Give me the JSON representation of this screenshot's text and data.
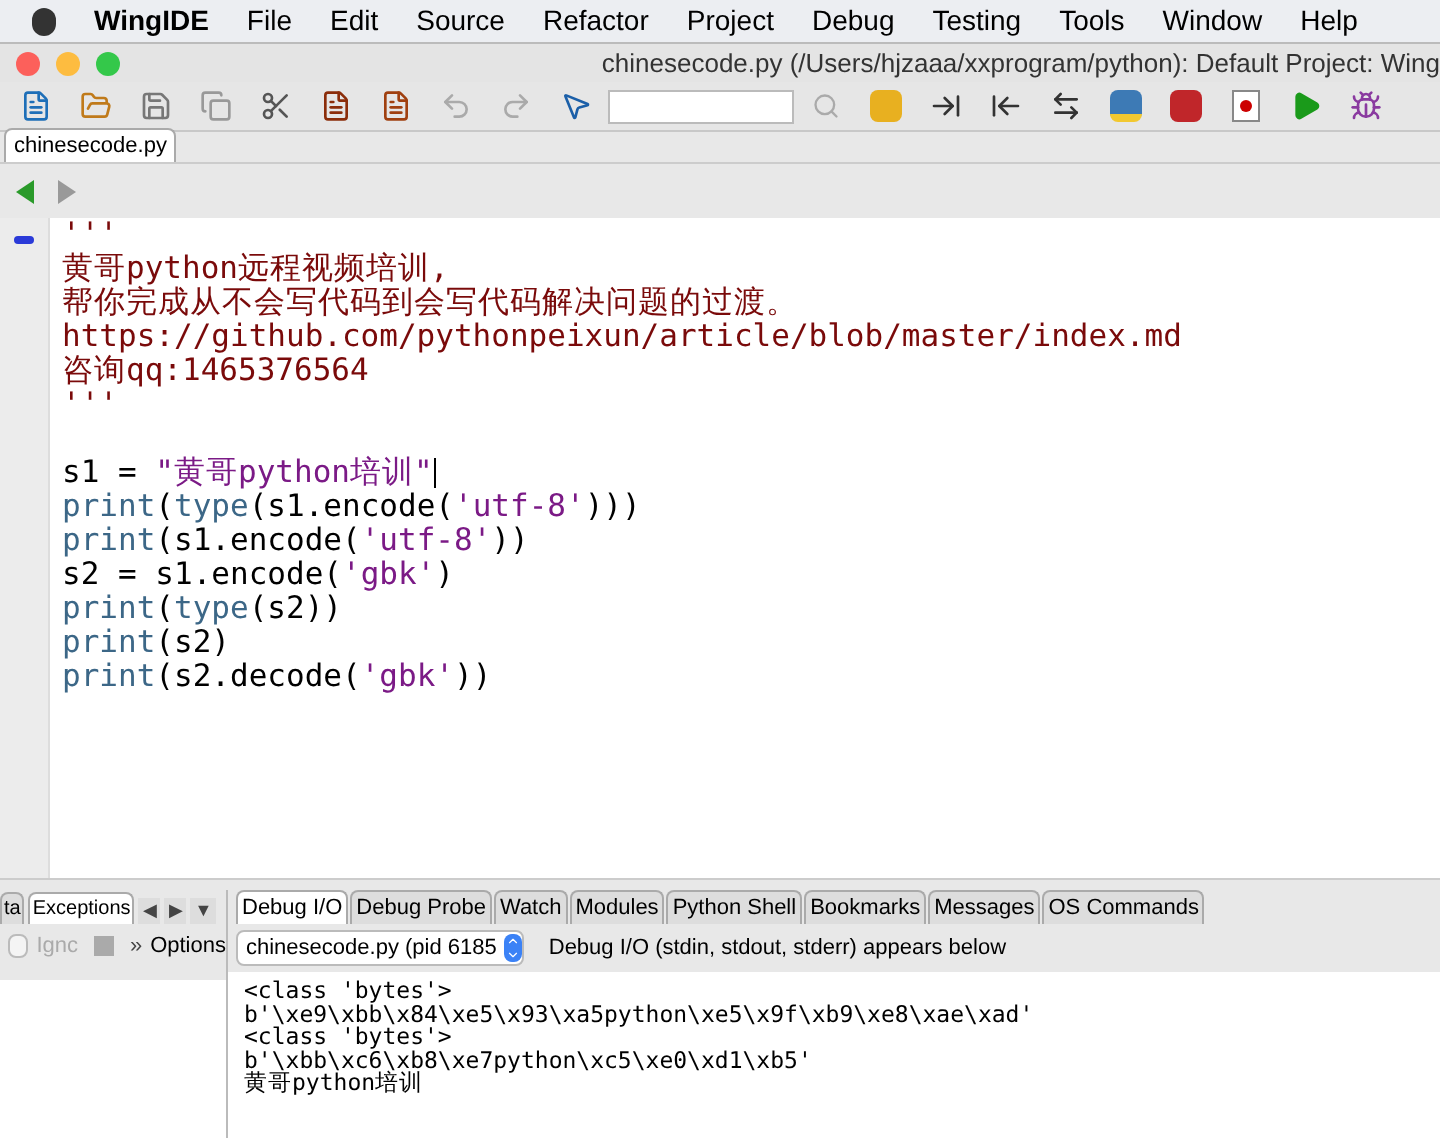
{
  "menu_bar": {
    "items": [
      "WingIDE",
      "File",
      "Edit",
      "Source",
      "Refactor",
      "Project",
      "Debug",
      "Testing",
      "Tools",
      "Window",
      "Help"
    ]
  },
  "window": {
    "title": "chinesecode.py (/Users/hjzaaa/xxprogram/python): Default Project: Wing"
  },
  "editor_tabs": [
    {
      "label": "chinesecode.py",
      "selected": true
    }
  ],
  "editor": {
    "lines": [
      {
        "cursor": false,
        "tokens": [
          {
            "kind": "doc",
            "text": "'''"
          }
        ]
      },
      {
        "cursor": false,
        "tokens": [
          {
            "kind": "doc",
            "text": "黄哥python远程视频培训,"
          }
        ]
      },
      {
        "cursor": false,
        "tokens": [
          {
            "kind": "doc",
            "text": "帮你完成从不会写代码到会写代码解决问题的过渡。"
          }
        ]
      },
      {
        "cursor": false,
        "tokens": [
          {
            "kind": "doc",
            "text": "https://github.com/pythonpeixun/article/blob/master/index.md"
          }
        ]
      },
      {
        "cursor": false,
        "tokens": [
          {
            "kind": "doc",
            "text": "咨询qq:1465376564"
          }
        ]
      },
      {
        "cursor": false,
        "tokens": [
          {
            "kind": "doc",
            "text": "'''"
          }
        ]
      },
      {
        "cursor": false
      },
      {
        "cursor": true,
        "tokens": [
          {
            "kind": "plain",
            "text": "s1 = "
          },
          {
            "kind": "string",
            "text": "\"黄哥python培训\""
          }
        ]
      },
      {
        "cursor": false,
        "tokens": [
          {
            "kind": "builtin",
            "text": "print"
          },
          {
            "kind": "plain",
            "text": "("
          },
          {
            "kind": "builtin",
            "text": "type"
          },
          {
            "kind": "plain",
            "text": "(s1.encode("
          },
          {
            "kind": "string",
            "text": "'utf-8'"
          },
          {
            "kind": "plain",
            "text": ")))"
          }
        ]
      },
      {
        "cursor": false,
        "tokens": [
          {
            "kind": "builtin",
            "text": "print"
          },
          {
            "kind": "plain",
            "text": "(s1.encode("
          },
          {
            "kind": "string",
            "text": "'utf-8'"
          },
          {
            "kind": "plain",
            "text": "))"
          }
        ]
      },
      {
        "cursor": false,
        "tokens": [
          {
            "kind": "plain",
            "text": "s2 = s1.encode("
          },
          {
            "kind": "string",
            "text": "'gbk'"
          },
          {
            "kind": "plain",
            "text": ")"
          }
        ]
      },
      {
        "cursor": false,
        "tokens": [
          {
            "kind": "builtin",
            "text": "print"
          },
          {
            "kind": "plain",
            "text": "("
          },
          {
            "kind": "builtin",
            "text": "type"
          },
          {
            "kind": "plain",
            "text": "(s2))"
          }
        ]
      },
      {
        "cursor": false,
        "tokens": [
          {
            "kind": "builtin",
            "text": "print"
          },
          {
            "kind": "plain",
            "text": "(s2)"
          }
        ]
      },
      {
        "cursor": false,
        "tokens": [
          {
            "kind": "builtin",
            "text": "print"
          },
          {
            "kind": "plain",
            "text": "(s2.decode("
          },
          {
            "kind": "string",
            "text": "'gbk'"
          },
          {
            "kind": "plain",
            "text": "))"
          }
        ]
      }
    ]
  },
  "left_panel": {
    "tabs": [
      {
        "label": "ta",
        "selected": false
      },
      {
        "label": "Exceptions",
        "selected": true
      }
    ],
    "scroll_arrows": [
      "◀",
      "▶",
      "▼"
    ],
    "ignore_checkbox": {
      "label": "Ignc",
      "checked": false
    },
    "options_chevron": "»",
    "options_label": "Options"
  },
  "debug_panel": {
    "tabs": [
      {
        "label": "Debug I/O",
        "selected": true
      },
      {
        "label": "Debug Probe",
        "selected": false
      },
      {
        "label": "Watch",
        "selected": false
      },
      {
        "label": "Modules",
        "selected": false
      },
      {
        "label": "Python Shell",
        "selected": false
      },
      {
        "label": "Bookmarks",
        "selected": false
      },
      {
        "label": "Messages",
        "selected": false
      },
      {
        "label": "OS Commands",
        "selected": false
      }
    ],
    "process_select": "chinesecode.py (pid 6185",
    "hint": "Debug I/O (stdin, stdout, stderr) appears below",
    "output": [
      "<class 'bytes'>",
      "b'\\xe9\\xbb\\x84\\xe5\\x93\\xa5python\\xe5\\x9f\\xb9\\xe8\\xae\\xad'",
      "<class 'bytes'>",
      "b'\\xbb\\xc6\\xb8\\xe7python\\xc5\\xe0\\xd1\\xb5'",
      "黄哥python培训"
    ]
  }
}
